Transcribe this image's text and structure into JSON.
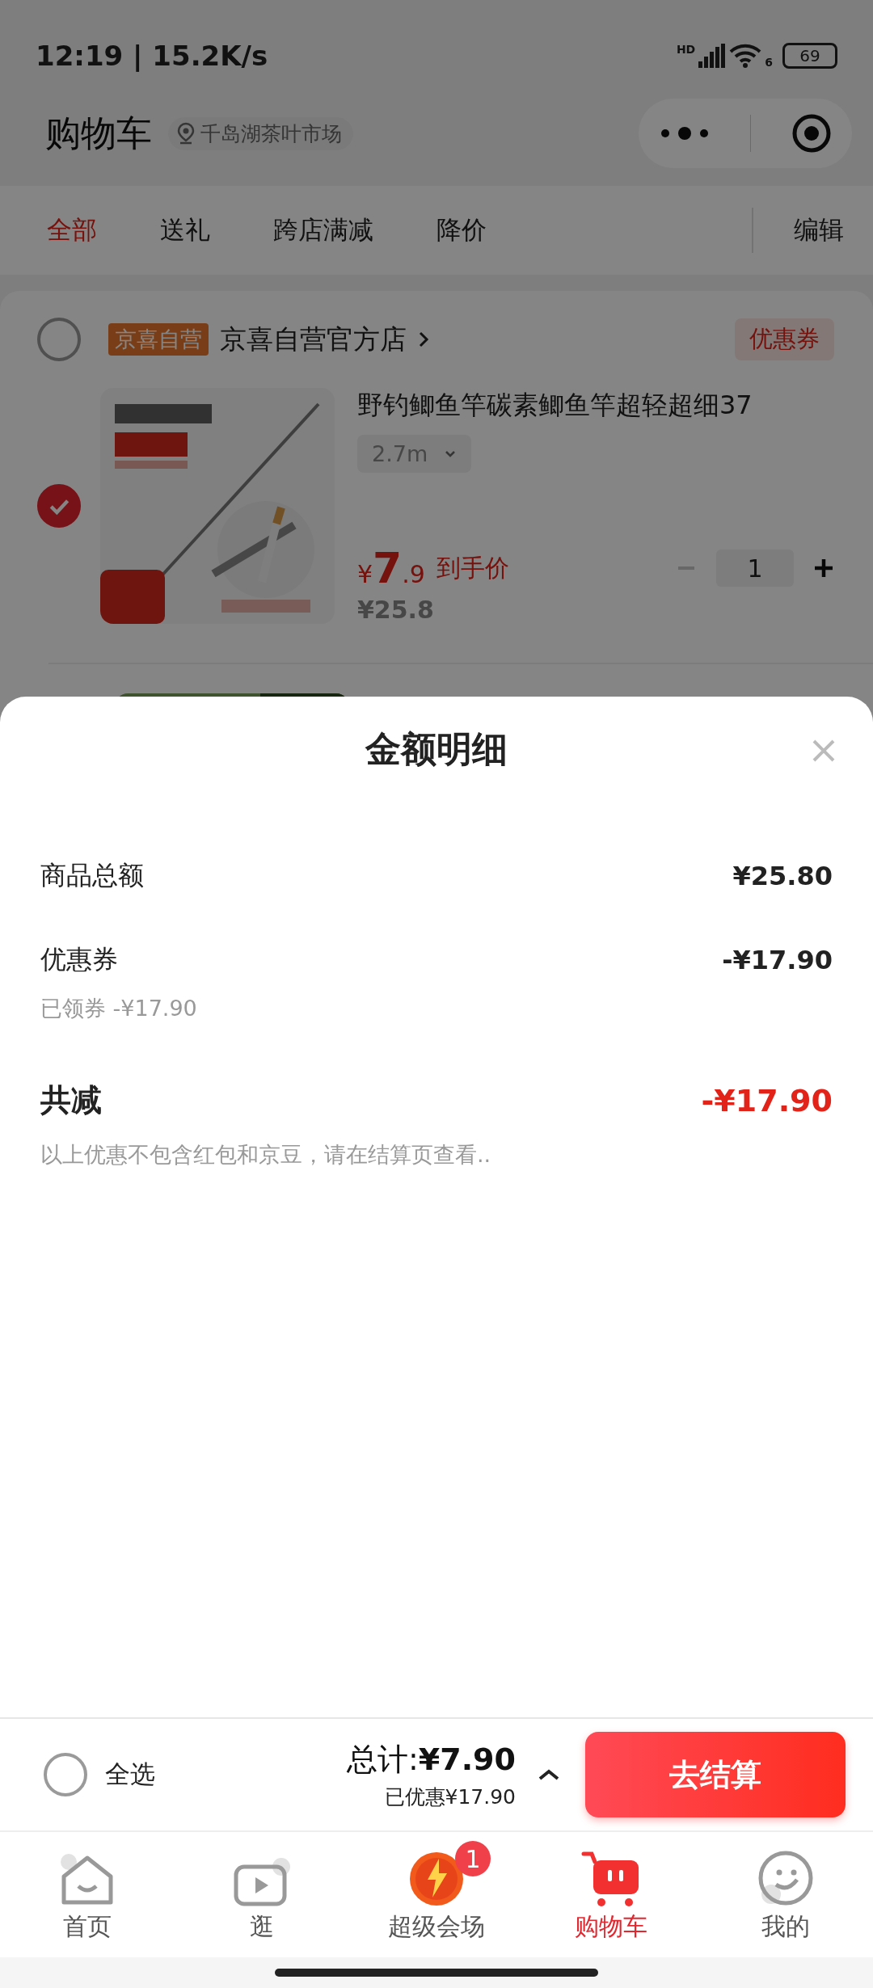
{
  "status_bar": {
    "time": "12:19 | 15.2K/s",
    "signal_label": "HD",
    "wifi_label": "6",
    "battery": "69"
  },
  "header": {
    "title": "购物车",
    "location": "千岛湖茶叶市场"
  },
  "tabs": [
    {
      "label": "全部",
      "selected": true
    },
    {
      "label": "送礼",
      "selected": false
    },
    {
      "label": "跨店满减",
      "selected": false
    },
    {
      "label": "降价",
      "selected": false
    }
  ],
  "edit_button": "编辑",
  "store": {
    "checked": false,
    "badge": "京喜自营",
    "name": "京喜自营官方店",
    "coupon": "优惠券"
  },
  "product": {
    "checked": true,
    "title": "野钓鲫鱼竿碳素鲫鱼竿超轻超细37",
    "spec": "2.7m",
    "currency": "¥",
    "price_integer": "7",
    "price_decimal": ".9",
    "price_label": "到手价",
    "original_price": "¥25.8",
    "quantity": "1",
    "minus_disabled": true
  },
  "sheet": {
    "title": "金额明细",
    "rows": [
      {
        "label": "商品总额",
        "value": "¥25.80"
      },
      {
        "label": "优惠券",
        "value": "-¥17.90",
        "note": "已领券 -¥17.90"
      }
    ],
    "total": {
      "label": "共减",
      "value": "-¥17.90"
    },
    "footnote": "以上优惠不包含红包和京豆，请在结算页查看.."
  },
  "checkout_bar": {
    "select_all": {
      "label": "全选",
      "checked": false
    },
    "total": "总计:**¥7.90**",
    "saved": "已优惠¥17.90",
    "button": "去结算"
  },
  "nav": [
    {
      "kind": "home",
      "label": "首页",
      "selected": false
    },
    {
      "kind": "video",
      "label": "逛",
      "selected": false
    },
    {
      "kind": "promo",
      "label": "超级会场",
      "selected": false,
      "badge": "1"
    },
    {
      "kind": "cart",
      "label": "购物车",
      "selected": true
    },
    {
      "kind": "profile",
      "label": "我的",
      "selected": false
    }
  ]
}
